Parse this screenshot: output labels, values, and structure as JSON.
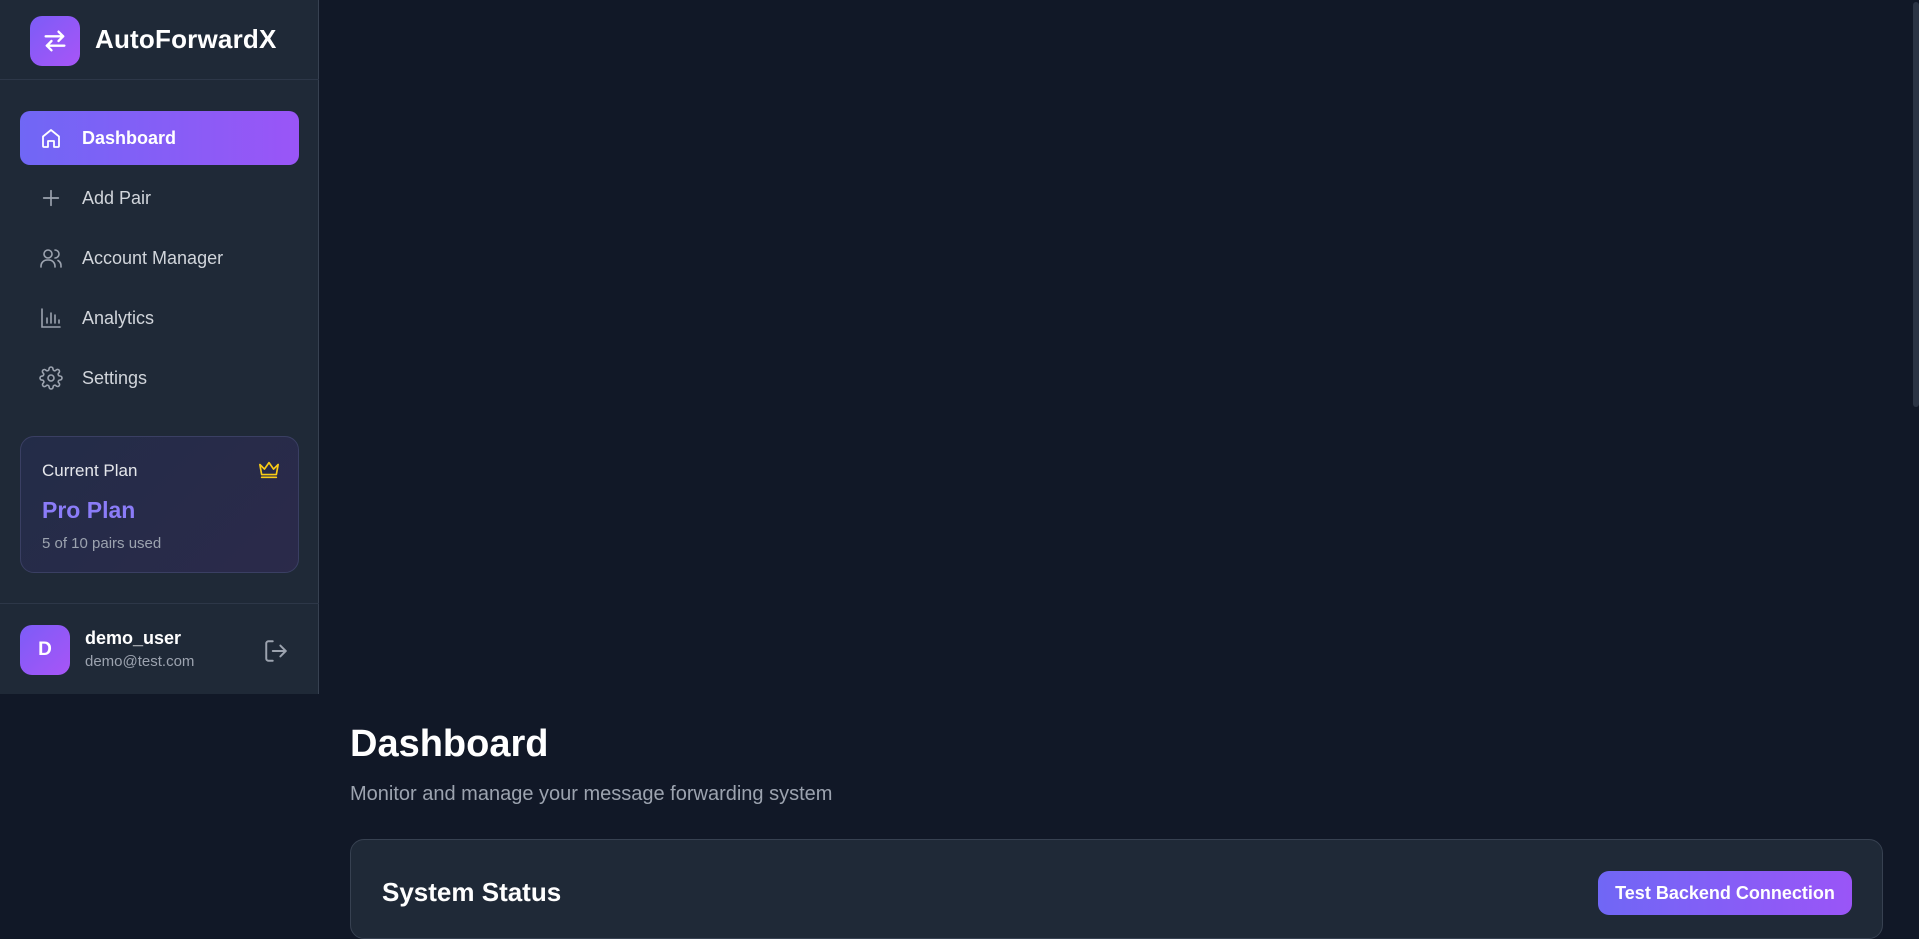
{
  "brand": {
    "title": "AutoForwardX"
  },
  "sidebar": {
    "items": [
      {
        "label": "Dashboard",
        "icon": "home-icon",
        "active": true
      },
      {
        "label": "Add Pair",
        "icon": "plus-icon",
        "active": false
      },
      {
        "label": "Account Manager",
        "icon": "users-icon",
        "active": false
      },
      {
        "label": "Analytics",
        "icon": "bar-chart-icon",
        "active": false
      },
      {
        "label": "Settings",
        "icon": "gear-icon",
        "active": false
      }
    ]
  },
  "plan": {
    "label": "Current Plan",
    "name": "Pro Plan",
    "usage": "5 of 10 pairs used",
    "icon": "crown-icon"
  },
  "user": {
    "initial": "D",
    "name": "demo_user",
    "email": "demo@test.com"
  },
  "main": {
    "title": "Dashboard",
    "subtitle": "Monitor and manage your message forwarding system",
    "status_card": {
      "title": "System Status",
      "button_label": "Test Backend Connection"
    }
  },
  "colors": {
    "background": "#111827",
    "sidebar": "#1f2937",
    "accent_start": "#7067f5",
    "accent_end": "#9a55f7",
    "plan_name": "#8b7cf8",
    "crown": "#facc15"
  }
}
